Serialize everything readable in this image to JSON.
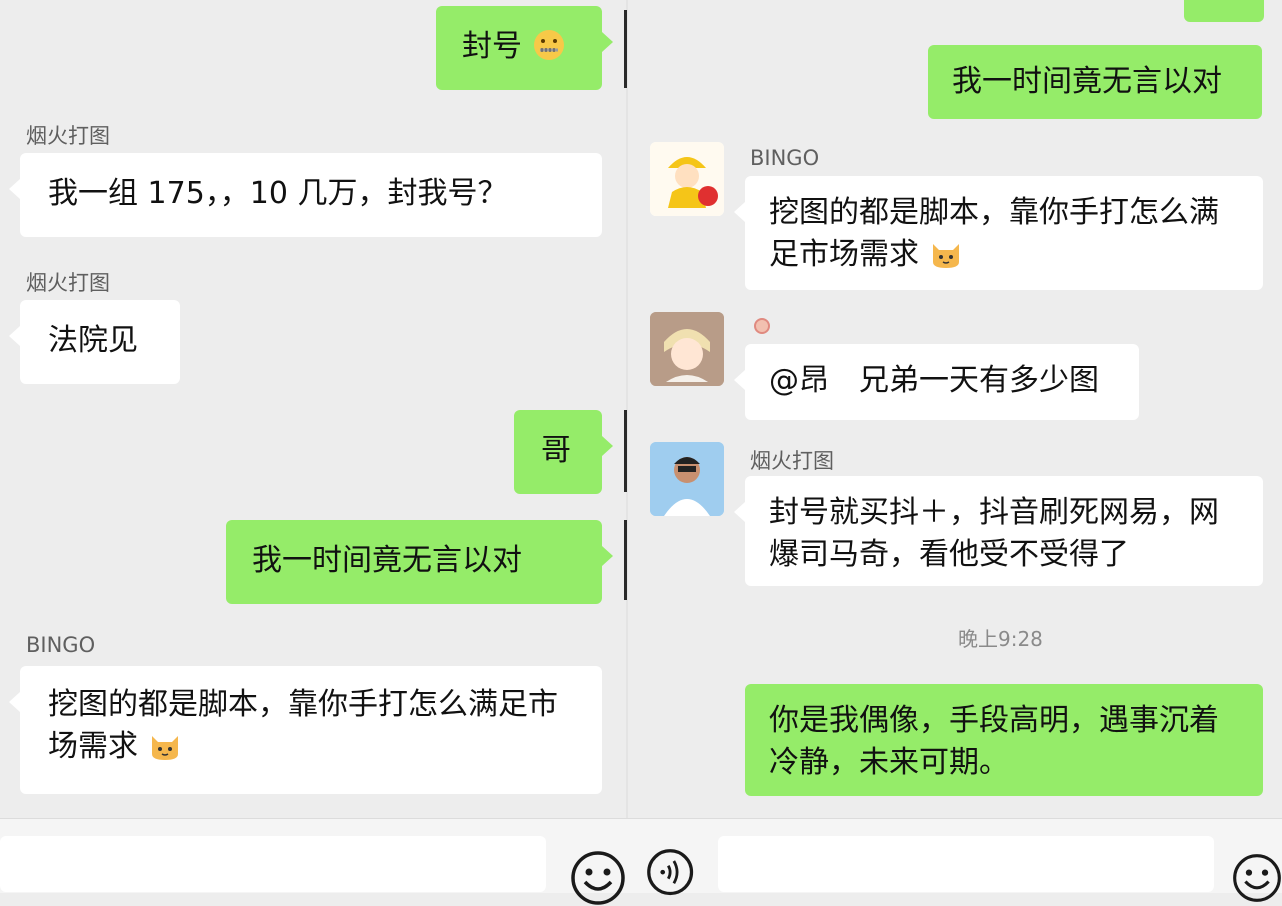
{
  "left": {
    "messages": [
      {
        "text": "封号"
      },
      {
        "sender": "烟火打图",
        "text": "我一组 175，，10 几万，封我号？"
      },
      {
        "sender": "烟火打图",
        "text": "法院见"
      },
      {
        "text": "哥"
      },
      {
        "text": "我一时间竟无言以对"
      },
      {
        "sender": "BINGO",
        "text": "挖图的都是脚本，靠你手打怎么满足市场需求"
      }
    ]
  },
  "right": {
    "messages": [
      {
        "text": "我一时间竟无言以对"
      },
      {
        "sender": "BINGO",
        "text": "挖图的都是脚本，靠你手打怎么满足市场需求"
      },
      {
        "text": "@昂　兄弟一天有多少图"
      },
      {
        "sender": "烟火打图",
        "text": "封号就买抖＋，抖音刷死网易，网爆司马奇，看他受不受得了"
      },
      {
        "text": "你是我偶像，手段高明，遇事沉着冷静，未来可期。"
      }
    ],
    "timestamp": "晚上9:28"
  },
  "icons": {
    "emoji": "emoji-icon",
    "voice": "voice-icon",
    "sticker": "cat-sticker-icon",
    "zipped_mouth": "zipper-mouth-emoji-icon"
  },
  "colors": {
    "background": "#ededed",
    "bubble_green": "#95ec69",
    "bubble_white": "#ffffff"
  }
}
